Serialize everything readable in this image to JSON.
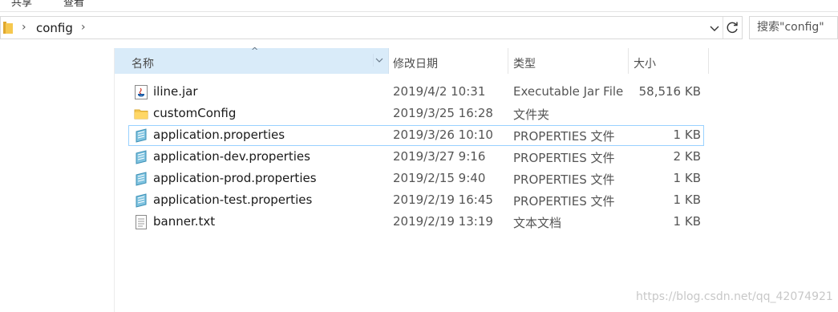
{
  "ribbon": {
    "tab_share": "共享",
    "tab_view": "查看"
  },
  "address": {
    "crumb": "config"
  },
  "search": {
    "placeholder": "搜索\"config\""
  },
  "columns": {
    "name": "名称",
    "date": "修改日期",
    "type": "类型",
    "size": "大小"
  },
  "files": [
    {
      "name": "iline.jar",
      "date": "2019/4/2 10:31",
      "type": "Executable Jar File",
      "size": "58,516 KB",
      "icon": "jar-file-icon"
    },
    {
      "name": "customConfig",
      "date": "2019/3/25 16:28",
      "type": "文件夹",
      "size": "",
      "icon": "folder-icon"
    },
    {
      "name": "application.properties",
      "date": "2019/3/26 10:10",
      "type": "PROPERTIES 文件",
      "size": "1 KB",
      "icon": "properties-file-icon"
    },
    {
      "name": "application-dev.properties",
      "date": "2019/3/27 9:16",
      "type": "PROPERTIES 文件",
      "size": "2 KB",
      "icon": "properties-file-icon"
    },
    {
      "name": "application-prod.properties",
      "date": "2019/2/15 9:40",
      "type": "PROPERTIES 文件",
      "size": "1 KB",
      "icon": "properties-file-icon"
    },
    {
      "name": "application-test.properties",
      "date": "2019/2/19 16:45",
      "type": "PROPERTIES 文件",
      "size": "1 KB",
      "icon": "properties-file-icon"
    },
    {
      "name": "banner.txt",
      "date": "2019/2/19 13:19",
      "type": "文本文档",
      "size": "1 KB",
      "icon": "text-file-icon"
    }
  ],
  "watermark": "https://blog.csdn.net/qq_42074921"
}
